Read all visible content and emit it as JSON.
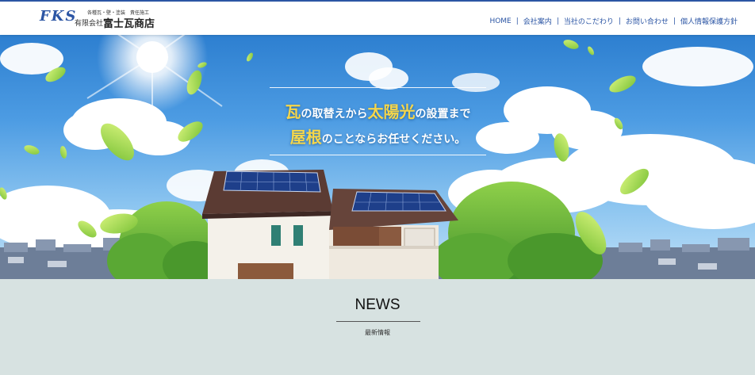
{
  "header": {
    "logo_mark": "FKS",
    "logo_tagline": "各種瓦・壁・塗装　責任施工",
    "logo_prefix": "有限会社",
    "logo_name": "富士瓦商店",
    "nav": [
      {
        "label": "HOME"
      },
      {
        "label": "会社案内"
      },
      {
        "label": "当社のこだわり"
      },
      {
        "label": "お問い合わせ"
      },
      {
        "label": "個人情報保護方針"
      }
    ],
    "nav_separator": "|"
  },
  "hero": {
    "line1": {
      "big1": "瓦",
      "mid1": "の取替えから",
      "big2": "太陽光",
      "mid2": "の設置まで"
    },
    "line2": {
      "big1": "屋根",
      "mid1": "のことならお任せください。"
    }
  },
  "news": {
    "title": "NEWS",
    "subtitle": "最新情報"
  },
  "colors": {
    "brand_blue": "#2b55a4",
    "headline_yellow": "#f6d64a",
    "news_bg": "#d7e2e1"
  }
}
